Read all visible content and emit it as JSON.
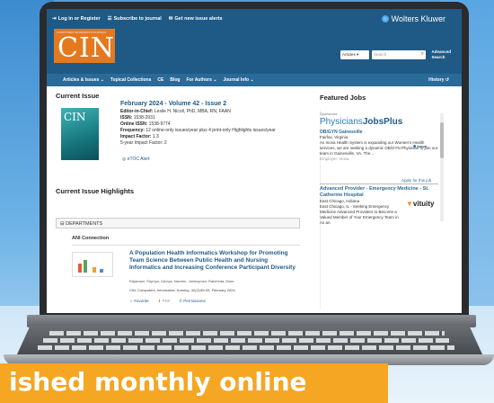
{
  "banner": {
    "text": "ished monthly online"
  },
  "header": {
    "login": "Log in or Register",
    "subscribe": "Subscribe to journal",
    "alerts": "Get new issue alerts",
    "publisher": "Wolters Kluwer",
    "journal_logo": "CIN",
    "journal_tagline": "COMPUTERS INFORMATICS NURSING",
    "search_scope": "Articles",
    "search_placeholder": "Search",
    "advanced_search": [
      "Advanced",
      "Search"
    ]
  },
  "nav": {
    "items": [
      "Articles & Issues",
      "Topical Collections",
      "CE",
      "Blog",
      "For Authors",
      "Journal Info"
    ],
    "history": "History"
  },
  "current_issue": {
    "heading": "Current Issue",
    "title": "February 2024 - Volume 42 - Issue 2",
    "editor_label": "Editor-in-Chief:",
    "editor_value": "Leslie H. Nicoll, PhD, MBA, RN, FAAN",
    "issn_label": "ISSN:",
    "issn_value": "1538-2931",
    "online_issn_label": "Online ISSN:",
    "online_issn_value": "1538-9774",
    "frequency_label": "Frequency:",
    "frequency_value": "12 online-only issues/year plus 4 print-only Highlights issues/year",
    "impact_label": "Impact Factor:",
    "impact_value": "1.3",
    "five_year_label": "5-year Impact Factor:",
    "five_year_value": "2",
    "etoc": "eTOC Alert",
    "cover_label": "CIN"
  },
  "highlights": {
    "heading": "Current Issue Highlights",
    "section": "DEPARTMENTS",
    "subsection": "ANI Connection",
    "article_title": "A Population Health Informatics Workshop for Promoting Team Science Between Public Health and Nursing Informatics and Increasing Conference Participant Diversity",
    "authors": "Rajamani, Sripriya; Odowa, Nazmin; Janisopolm; Ratcheda; More",
    "citation": "CIN: Computers, Informatics, Nursing. 42(2):89-93, February 2024.",
    "actions": [
      "Favorite",
      "PDF",
      "Permissions"
    ]
  },
  "featured_jobs": {
    "heading": "Featured Jobs",
    "sponsor": "Sponsored",
    "board_name_1": "Physicians",
    "board_name_2": "JobsPlus",
    "job1_title": "OB/GYN Gainesville",
    "job1_location": "Fairfax, Virginia",
    "job1_desc": "As Inova Health System is expanding our Women's Health services, we are seeking a dynamic OB/GYN Physician to join our team in Gainesville, VA. The...",
    "job1_employer": "Employer: Inova",
    "job1_badge": "Inova",
    "apply": "Apply for this job",
    "job2_title": "Advanced Provider - Emergency Medicine - St. Catherine Hospital",
    "job2_location": "East Chicago, Indiana",
    "job2_desc": "East Chicago, IL - Seeking Emergency Medicine Advanced Providers to Become a Valued Member of Your Emergency Team in As an",
    "job2_logo": "vituity"
  },
  "colors": {
    "header": "#1f5a86",
    "accent": "#e4791e",
    "banner": "#f5a623"
  }
}
